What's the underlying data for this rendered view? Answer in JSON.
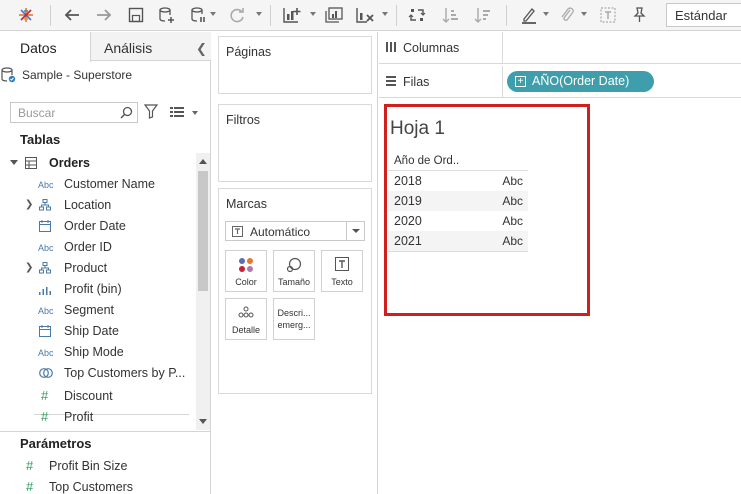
{
  "toolbar": {
    "standard_label": "Estándar"
  },
  "left_pane": {
    "tab_data": "Datos",
    "tab_analysis": "Análisis",
    "data_source": "Sample - Superstore",
    "search_placeholder": "Buscar",
    "tables_title": "Tablas",
    "table_name": "Orders",
    "fields": [
      {
        "name": "Customer Name",
        "icon": "Abc",
        "expandable": false
      },
      {
        "name": "Location",
        "icon": "hierarchy",
        "expandable": true
      },
      {
        "name": "Order Date",
        "icon": "calendar",
        "expandable": false
      },
      {
        "name": "Order ID",
        "icon": "Abc",
        "expandable": false
      },
      {
        "name": "Product",
        "icon": "hierarchy",
        "expandable": true
      },
      {
        "name": "Profit (bin)",
        "icon": "bins",
        "expandable": false
      },
      {
        "name": "Segment",
        "icon": "Abc",
        "expandable": false
      },
      {
        "name": "Ship Date",
        "icon": "calendar",
        "expandable": false
      },
      {
        "name": "Ship Mode",
        "icon": "Abc",
        "expandable": false
      },
      {
        "name": "Top Customers by P...",
        "icon": "set",
        "expandable": false
      },
      {
        "name": "Discount",
        "icon": "#",
        "expandable": false
      },
      {
        "name": "Profit",
        "icon": "#",
        "expandable": false
      }
    ],
    "params_title": "Parámetros",
    "params": [
      {
        "name": "Profit Bin Size",
        "icon": "#"
      },
      {
        "name": "Top Customers",
        "icon": "#"
      }
    ]
  },
  "middle_pane": {
    "pages_title": "Páginas",
    "filters_title": "Filtros",
    "marks_title": "Marcas",
    "mark_type": "Automático",
    "mark_buttons": [
      "Color",
      "Tamaño",
      "Texto",
      "Detalle",
      "Descri... emerg..."
    ]
  },
  "shelves": {
    "columns_label": "Columnas",
    "rows_label": "Filas",
    "rows_pill": "AÑO(Order Date)"
  },
  "view": {
    "sheet_title": "Hoja 1",
    "column_header": "Año de Ord..",
    "rows": [
      {
        "year": "2018",
        "value": "Abc"
      },
      {
        "year": "2019",
        "value": "Abc"
      },
      {
        "year": "2020",
        "value": "Abc"
      },
      {
        "year": "2021",
        "value": "Abc"
      }
    ],
    "highlight_color": "#d01f1f",
    "pill_color": "#3e9eab"
  }
}
